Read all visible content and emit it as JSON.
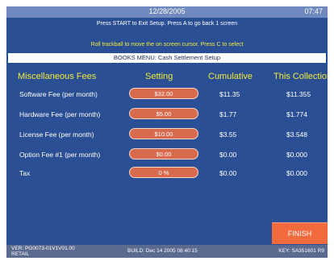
{
  "header": {
    "date": "12/28/2005",
    "time": "07:47"
  },
  "instructions": {
    "line1": "Press START to Exit Setup. Press A to go back 1 screen",
    "line2": "Roll trackball to move the on screen cursor. Press C to select"
  },
  "menu_title": "BOOKS MENU: Cash Settlement Setup",
  "columns": {
    "name": "Miscellaneous Fees",
    "setting": "Setting",
    "cumulative": "Cumulative",
    "collection": "This Collection"
  },
  "rows": [
    {
      "label": "Software Fee (per month)",
      "setting": "$32.00",
      "cumulative": "$11.35",
      "collection": "$11.355"
    },
    {
      "label": "Hardware Fee (per month)",
      "setting": "$5.00",
      "cumulative": "$1.77",
      "collection": "$1.774"
    },
    {
      "label": "License Fee (per month)",
      "setting": "$10.00",
      "cumulative": "$3.55",
      "collection": "$3.548"
    },
    {
      "label": "Option Fee #1 (per month)",
      "setting": "$0.00",
      "cumulative": "$0.00",
      "collection": "$0.000"
    },
    {
      "label": "Tax",
      "setting": "0 %",
      "cumulative": "$0.00",
      "collection": "$0.000"
    }
  ],
  "finish_label": "FINISH",
  "footer": {
    "version_line1": "VER: PG0073-01V1V01.00",
    "version_line2": "RETAIL",
    "build": "BUILD: Dec 14 2005   08:40:15",
    "key": "KEY: SA351601 R9"
  },
  "colors": {
    "screen_bg": "#2a4f94",
    "heading_yellow": "#f2ea3c",
    "pill_orange": "#d86a4e",
    "finish_orange": "#f26a3d"
  }
}
